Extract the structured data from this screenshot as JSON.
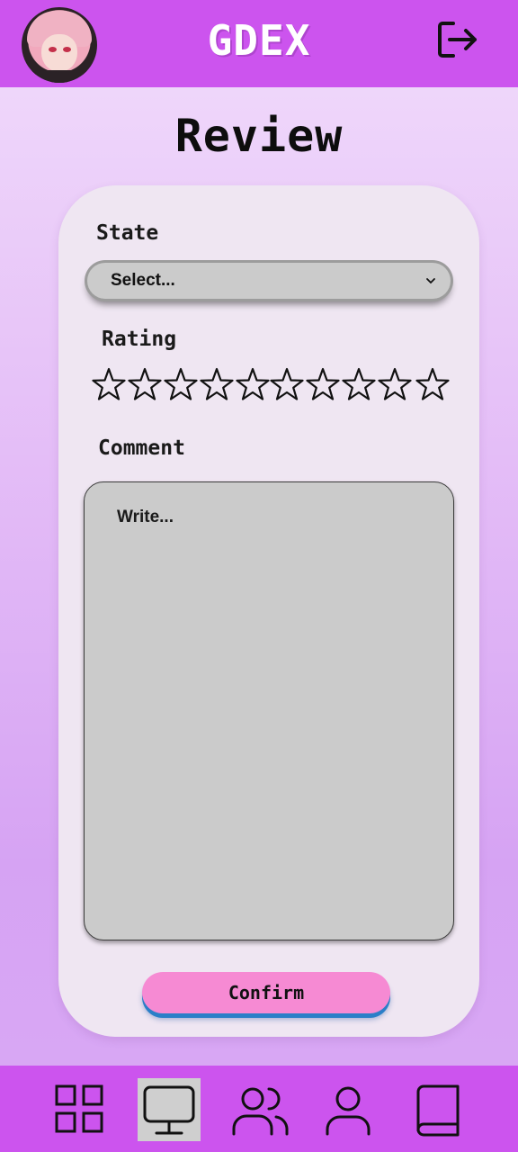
{
  "header": {
    "app_title": "GDEX",
    "avatar_icon": "user-avatar",
    "logout_icon": "logout-icon"
  },
  "page": {
    "title": "Review"
  },
  "form": {
    "state_label": "State",
    "state_select_value": "Select...",
    "rating_label": "Rating",
    "rating": {
      "value": 0,
      "max": 10
    },
    "comment_label": "Comment",
    "comment_placeholder": "Write...",
    "confirm_label": "Confirm"
  },
  "nav": {
    "items": [
      {
        "icon": "grid-icon",
        "active": false
      },
      {
        "icon": "monitor-icon",
        "active": true
      },
      {
        "icon": "users-icon",
        "active": false
      },
      {
        "icon": "user-icon",
        "active": false
      },
      {
        "icon": "book-icon",
        "active": false
      }
    ]
  },
  "colors": {
    "header_bg": "#cc54ee",
    "card_bg": "#efe6f2",
    "input_bg": "#cbcbcb",
    "confirm_bg": "#f68ad3",
    "confirm_shadow": "#2a7fc8"
  }
}
